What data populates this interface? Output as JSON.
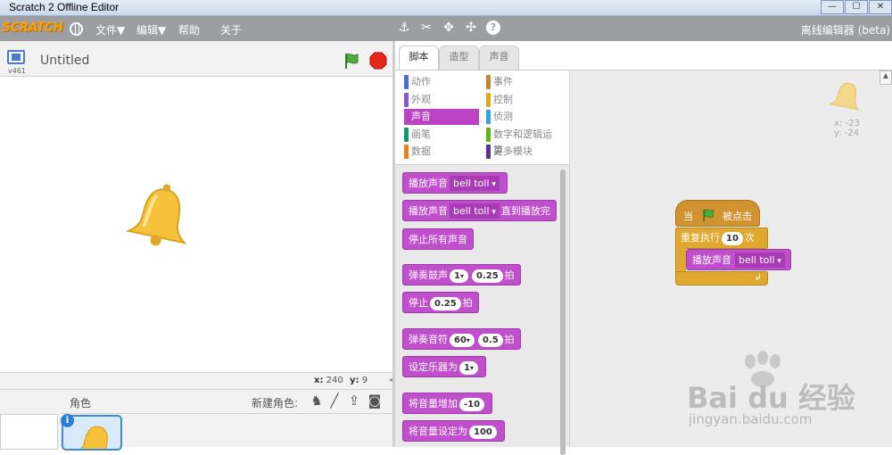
{
  "window": {
    "title": "Scratch 2 Offline Editor",
    "buttons": [
      "—",
      "☐",
      "✕"
    ]
  },
  "menubar": {
    "logo": "SCRATCH",
    "items": [
      "文件▼",
      "编辑▼",
      "帮助",
      "关于"
    ],
    "edition": "离线编辑器 (beta)"
  },
  "stage": {
    "project_title": "Untitled",
    "version": "v461",
    "coords": {
      "x_label": "x:",
      "x": "240",
      "y_label": "y:",
      "y": "9"
    },
    "sprite_costume": "bell"
  },
  "sprites": {
    "label": "角色",
    "new_sprite_label": "新建角色:",
    "info": "i"
  },
  "tabs": [
    "脚本",
    "造型",
    "声音"
  ],
  "categories": {
    "left": [
      {
        "label": "动作",
        "color": "#4a6cd4"
      },
      {
        "label": "外观",
        "color": "#8a55d7"
      },
      {
        "label": "声音",
        "color": "#bb42c3"
      },
      {
        "label": "画笔",
        "color": "#0e9a6c"
      },
      {
        "label": "数据",
        "color": "#ee7d16"
      }
    ],
    "right": [
      {
        "label": "事件",
        "color": "#c88330"
      },
      {
        "label": "控制",
        "color": "#e1a91a"
      },
      {
        "label": "侦测",
        "color": "#2ca5e2"
      },
      {
        "label": "数字和逻辑运算",
        "color": "#5cb712"
      },
      {
        "label": "更多模块",
        "color": "#632d99"
      }
    ],
    "selected": "声音"
  },
  "palette": {
    "play_sound": "播放声音",
    "play_sound_until": "直到播放完",
    "sound": "bell toll",
    "stop_all": "停止所有声音",
    "play_drum": "弹奏鼓声",
    "drum": "1",
    "beats": "0.25",
    "beat_unit": "拍",
    "rest": "停止",
    "play_note": "弹奏音符",
    "note": "60",
    "note_beats": "0.5",
    "set_instrument": "设定乐器为",
    "instrument": "1",
    "change_volume": "将音量增加",
    "volume_delta": "-10",
    "set_volume": "将音量设定为",
    "volume": "100"
  },
  "script": {
    "hat_prefix": "当",
    "hat_suffix": "被点击",
    "repeat": "重复执行",
    "repeat_count": "10",
    "repeat_unit": "次",
    "inner": "播放声音",
    "inner_sound": "bell toll",
    "loop_arrow": "↲"
  },
  "sprite_info": {
    "x_label": "x:",
    "x": "-23",
    "y_label": "y:",
    "y": "-24"
  },
  "watermark": {
    "brand": "Bai du 经验",
    "url": "jingyan.baidu.com"
  }
}
